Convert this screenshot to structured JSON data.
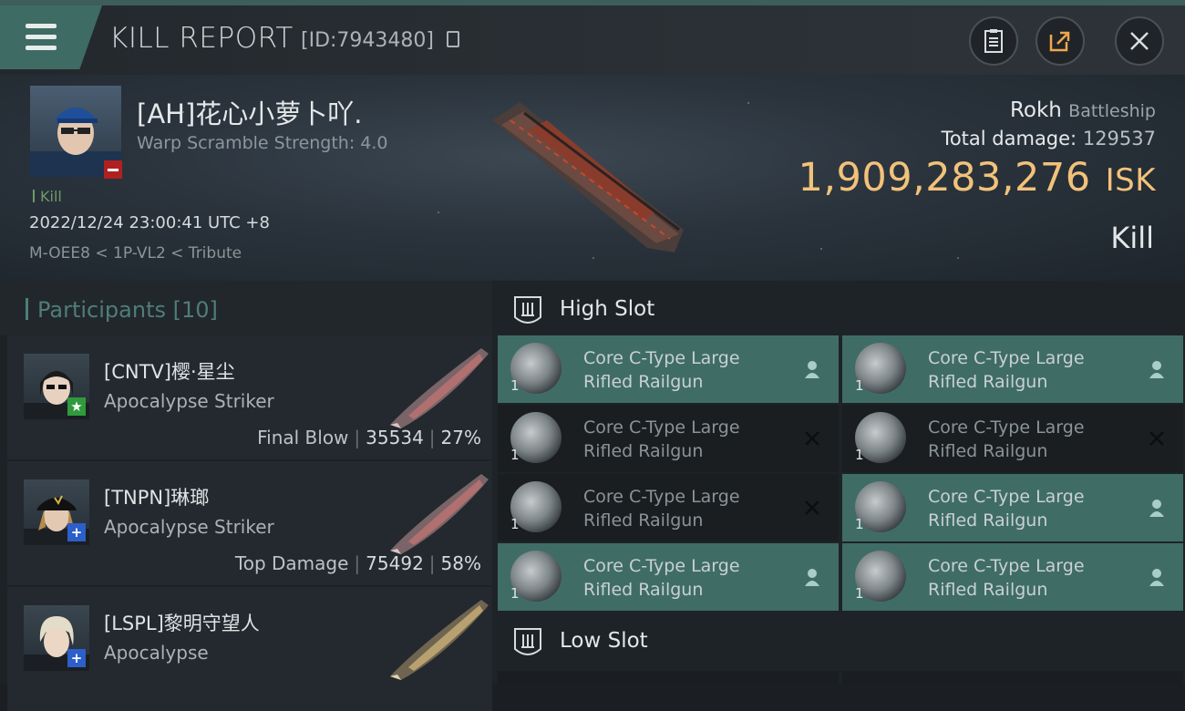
{
  "header": {
    "title": "KILL REPORT",
    "report_id": "[ID:7943480]",
    "buttons": [
      "clipboard",
      "share",
      "close"
    ]
  },
  "victim": {
    "name": "[AH]花心小萝卜吖.",
    "warp_scramble": "Warp Scramble Strength: 4.0",
    "tag": "Kill",
    "datetime": "2022/12/24 23:00:41 UTC +8",
    "location": "M-OEE8 < 1P-VL2 < Tribute",
    "ship_name": "Rokh",
    "ship_class": "Battleship",
    "total_damage_label": "Total damage:",
    "total_damage_value": "129537",
    "isk_value": "1,909,283,276",
    "isk_unit": "ISK",
    "result": "Kill"
  },
  "participants": {
    "title": "Participants",
    "count": "[10]",
    "items": [
      {
        "name": "[CNTV]樱·星尘",
        "ship": "Apocalypse Striker",
        "stat_label": "Final Blow",
        "damage": "35534",
        "percent": "27%",
        "badge": "★",
        "badge_color": "#2f9a3c"
      },
      {
        "name": "[TNPN]琳瑯",
        "ship": "Apocalypse Striker",
        "stat_label": "Top Damage",
        "damage": "75492",
        "percent": "58%",
        "badge": "+",
        "badge_color": "#2c5fc9"
      },
      {
        "name": "[LSPL]黎明守望人",
        "ship": "Apocalypse",
        "stat_label": "",
        "damage": "",
        "percent": "",
        "badge": "+",
        "badge_color": "#2c5fc9"
      }
    ]
  },
  "slots": {
    "high": {
      "title": "High Slot",
      "modules": [
        {
          "line1": "Core C-Type Large",
          "line2": "Rifled Railgun",
          "qty": "1",
          "state": "active"
        },
        {
          "line1": "Core C-Type Large",
          "line2": "Rifled Railgun",
          "qty": "1",
          "state": "active"
        },
        {
          "line1": "Core C-Type Large",
          "line2": "Rifled Railgun",
          "qty": "1",
          "state": "inactive"
        },
        {
          "line1": "Core C-Type Large",
          "line2": "Rifled Railgun",
          "qty": "1",
          "state": "inactive"
        },
        {
          "line1": "Core C-Type Large",
          "line2": "Rifled Railgun",
          "qty": "1",
          "state": "inactive"
        },
        {
          "line1": "Core C-Type Large",
          "line2": "Rifled Railgun",
          "qty": "1",
          "state": "active"
        },
        {
          "line1": "Core C-Type Large",
          "line2": "Rifled Railgun",
          "qty": "1",
          "state": "active"
        },
        {
          "line1": "Core C-Type Large",
          "line2": "Rifled Railgun",
          "qty": "1",
          "state": "active"
        }
      ]
    },
    "low": {
      "title": "Low Slot"
    }
  }
}
